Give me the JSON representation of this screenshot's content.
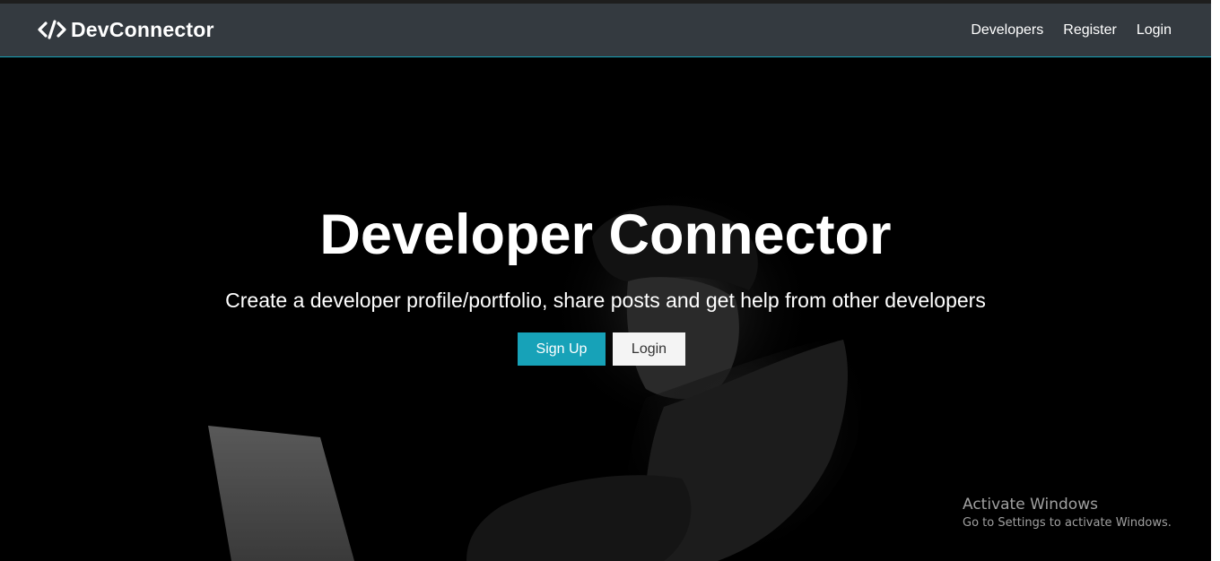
{
  "navbar": {
    "brand": "DevConnector",
    "brand_icon": "code-icon",
    "links": [
      {
        "label": "Developers"
      },
      {
        "label": "Register"
      },
      {
        "label": "Login"
      }
    ]
  },
  "hero": {
    "title": "Developer Connector",
    "lead": "Create a developer profile/portfolio, share posts and get help from other developers",
    "signup_label": "Sign Up",
    "login_label": "Login"
  },
  "os_overlay": {
    "title": "Activate Windows",
    "subtitle": "Go to Settings to activate Windows."
  },
  "colors": {
    "navbar_bg": "#343a40",
    "primary": "#17a2b8",
    "light": "#f4f4f4",
    "hero_bg": "#000000"
  }
}
